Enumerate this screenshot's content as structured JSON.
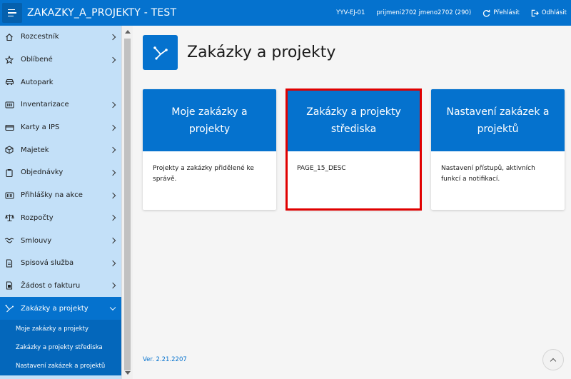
{
  "header": {
    "app_title": "ZAKAZKY_A_PROJEKTY - TEST",
    "env_code": "YYV-EJ-01",
    "user": "prijmeni2702 jmeno2702 (290)",
    "switch_label": "Přehlásit",
    "logout_label": "Odhlásit"
  },
  "sidebar": {
    "items": [
      {
        "label": "Rozcestník",
        "icon": "home-icon"
      },
      {
        "label": "Oblíbené",
        "icon": "star-icon"
      },
      {
        "label": "Autopark",
        "icon": "car-icon"
      },
      {
        "label": "Inventarizace",
        "icon": "barcode-icon"
      },
      {
        "label": "Karty a IPS",
        "icon": "card-icon"
      },
      {
        "label": "Majetek",
        "icon": "box-icon"
      },
      {
        "label": "Objednávky",
        "icon": "clipboard-icon"
      },
      {
        "label": "Přihlášky na akce",
        "icon": "ticket-icon"
      },
      {
        "label": "Rozpočty",
        "icon": "scales-icon"
      },
      {
        "label": "Smlouvy",
        "icon": "handshake-icon"
      },
      {
        "label": "Spisová služba",
        "icon": "file-icon"
      },
      {
        "label": "Žádost o fakturu",
        "icon": "invoice-icon"
      },
      {
        "label": "Zakázky a projekty",
        "icon": "graph-icon"
      }
    ],
    "sub_items": [
      {
        "label": "Moje zakázky a projekty"
      },
      {
        "label": "Zakázky a projekty střediska"
      },
      {
        "label": "Nastavení zakázek a projektů"
      }
    ]
  },
  "main": {
    "page_title": "Zakázky a projekty",
    "cards": [
      {
        "title": "Moje zakázky a projekty",
        "description": "Projekty a zakázky přidělené ke správě."
      },
      {
        "title": "Zakázky a projekty střediska",
        "description": "PAGE_15_DESC"
      },
      {
        "title": "Nastavení zakázek a projektů",
        "description": "Nastavení přístupů, aktivních funkcí a notifikací."
      }
    ],
    "version": "Ver. 2.21.2207"
  },
  "colors": {
    "brand_blue": "#0572ce",
    "sidebar_bg": "#c3e0f8",
    "highlight": "#e00000"
  }
}
